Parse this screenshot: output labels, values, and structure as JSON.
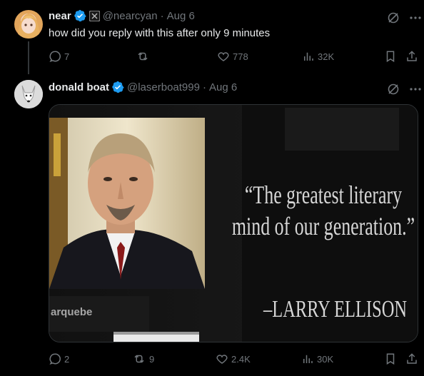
{
  "tweets": [
    {
      "name": "near",
      "handle": "@nearcyan",
      "separator": "·",
      "date": "Aug 6",
      "text": "how did you reply with this after only 9 minutes",
      "stats": {
        "replies": "7",
        "retweets": "",
        "likes": "778",
        "views": "32K"
      }
    },
    {
      "name": "donald boat",
      "handle": "@laserboat999",
      "separator": "·",
      "date": "Aug 6",
      "stats": {
        "replies": "2",
        "retweets": "9",
        "likes": "2.4K",
        "views": "30K"
      }
    }
  ],
  "media": {
    "quote_line1": "“The greatest literary",
    "quote_line2": "mind of our generation.”",
    "attribution": "–LARRY ELLISON",
    "caption": "arquebe"
  },
  "icons": [
    "verified-badge-icon",
    "affiliate-badge-icon",
    "grok-icon",
    "more-icon",
    "reply-icon",
    "retweet-icon",
    "like-icon",
    "views-icon",
    "bookmark-icon",
    "share-icon"
  ],
  "colors": {
    "background": "#000000",
    "text": "#e7e9ea",
    "muted": "#71767b",
    "verified": "#1d9bf0"
  }
}
